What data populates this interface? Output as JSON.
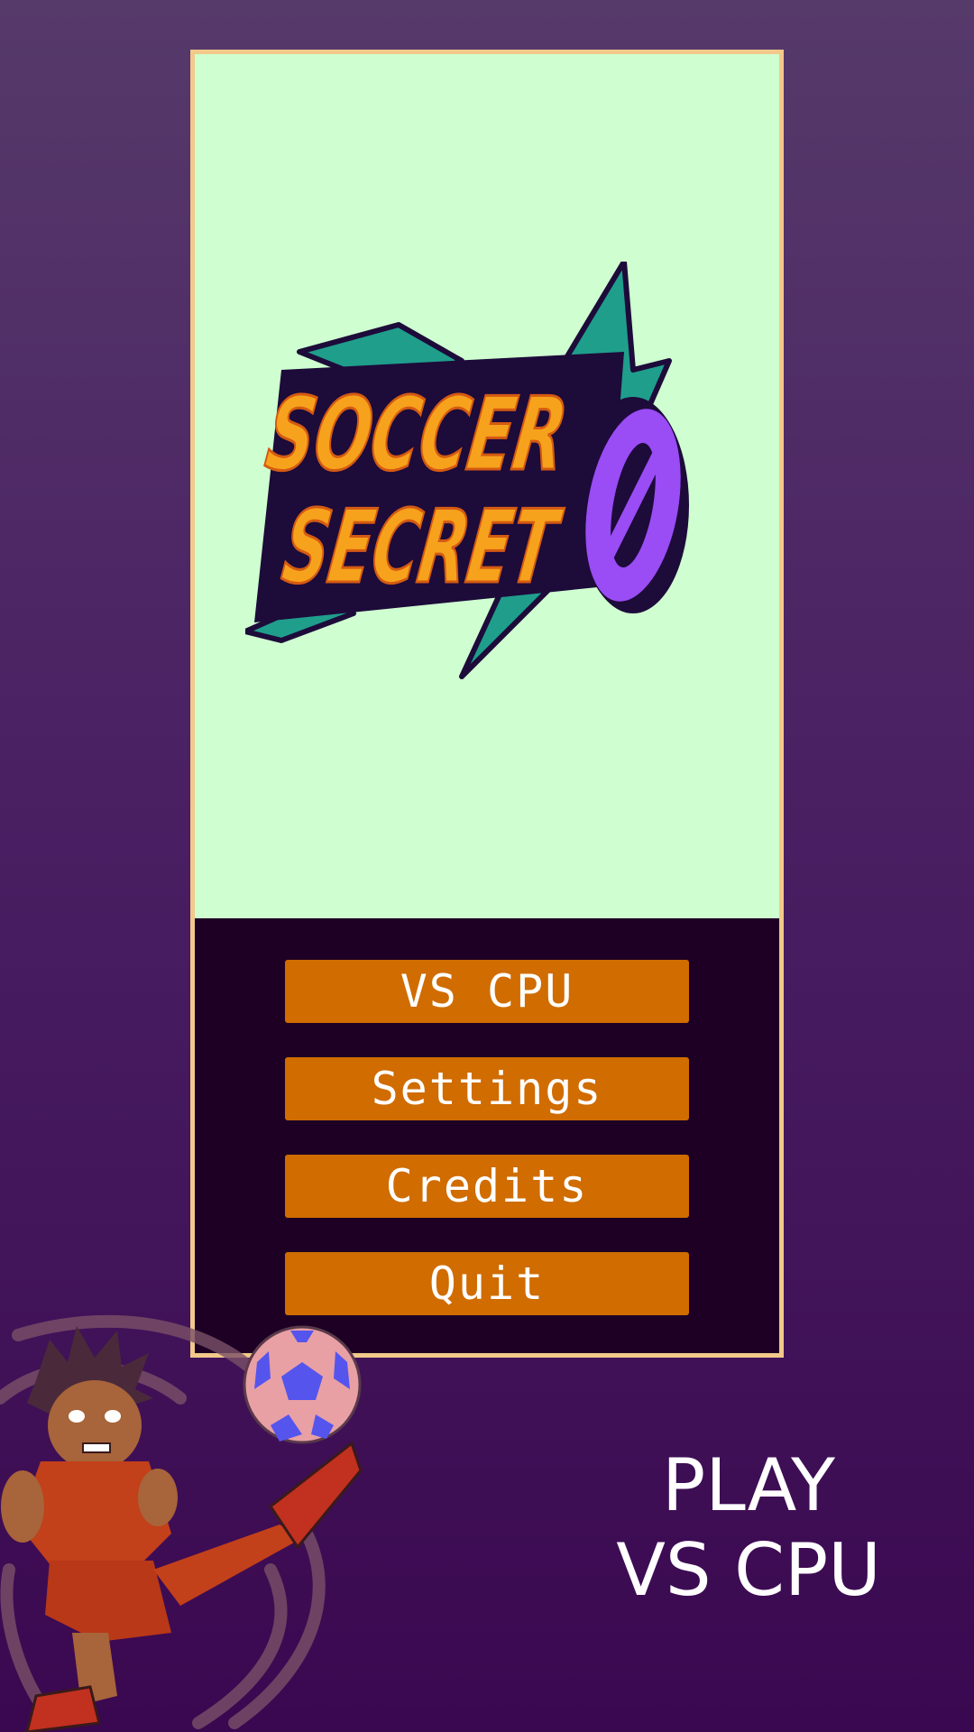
{
  "game": {
    "logo_text": {
      "line1": "SOCCER",
      "line2": "SECRET",
      "mark": "0"
    }
  },
  "menu": {
    "buttons": [
      {
        "label": "VS CPU"
      },
      {
        "label": "Settings"
      },
      {
        "label": "Credits"
      },
      {
        "label": "Quit"
      }
    ]
  },
  "hint": {
    "line1": "PLAY",
    "line2": "VS CPU"
  },
  "colors": {
    "background_top": "#563a6a",
    "background_bottom": "#3a0850",
    "frame_border": "#f2c98a",
    "title_panel": "#cfffd0",
    "menu_panel": "#1d0024",
    "button": "#d06c00",
    "button_text": "#ffffff",
    "logo_orange": "#f7a21c",
    "logo_teal": "#1f9e8c",
    "logo_purple": "#9a4cf5"
  },
  "icons": {
    "logo": "soccer-secret-zero-logo",
    "player": "kicking-player-illustration",
    "ball": "soccer-ball-icon"
  }
}
